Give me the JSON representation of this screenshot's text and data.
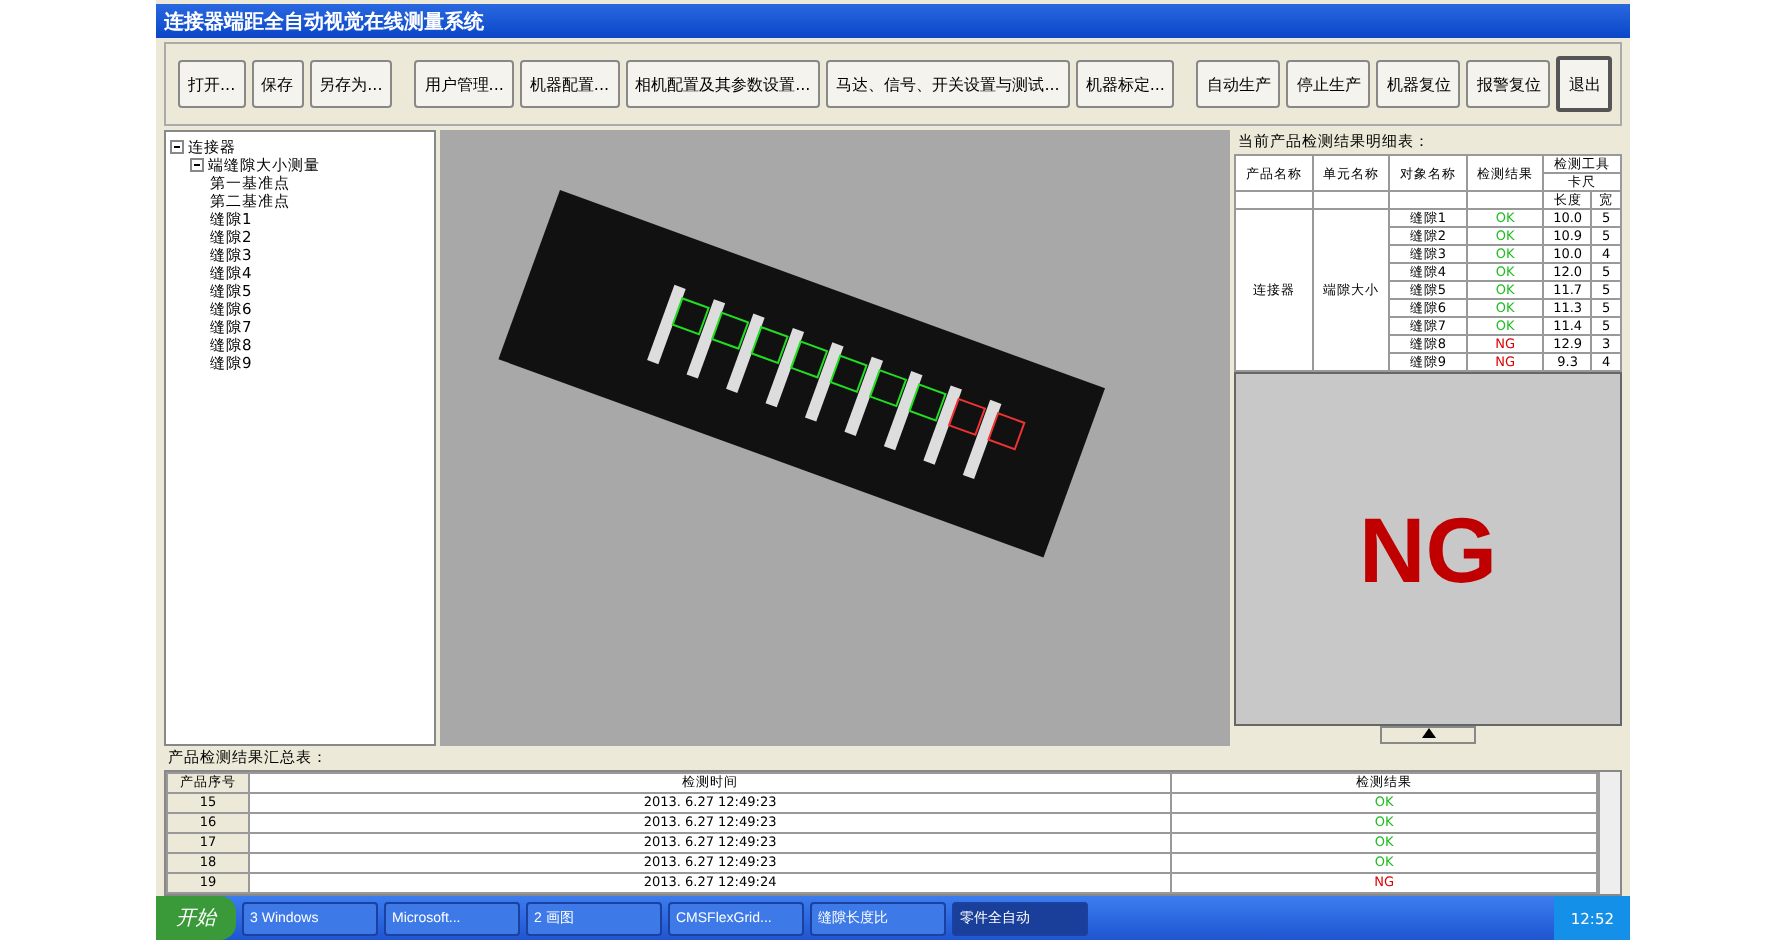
{
  "window": {
    "title": "连接器端距全自动视觉在线测量系统"
  },
  "toolbar": [
    "打开...",
    "保存",
    "另存为...",
    "用户管理...",
    "机器配置...",
    "相机配置及其参数设置...",
    "马达、信号、开关设置与测试...",
    "机器标定...",
    "自动生产",
    "停止生产",
    "机器复位",
    "报警复位"
  ],
  "exit_button": "退出",
  "tree": [
    {
      "label": "连接器",
      "expanded": true,
      "children": [
        {
          "label": "端缝隙大小测量",
          "expanded": true,
          "children": [
            {
              "label": "第一基准点"
            },
            {
              "label": "第二基准点"
            },
            {
              "label": "缝隙1"
            },
            {
              "label": "缝隙2"
            },
            {
              "label": "缝隙3"
            },
            {
              "label": "缝隙4"
            },
            {
              "label": "缝隙5"
            },
            {
              "label": "缝隙6"
            },
            {
              "label": "缝隙7"
            },
            {
              "label": "缝隙8"
            },
            {
              "label": "缝隙9"
            }
          ]
        }
      ]
    }
  ],
  "detail": {
    "title": "当前产品检测结果明细表：",
    "columns": [
      "产品名称",
      "单元名称",
      "对象名称",
      "检测结果",
      "检测工具"
    ],
    "tool_name": "卡尺",
    "subcolumns": [
      "长度",
      "宽"
    ],
    "product": "连接器",
    "unit": "端隙大小",
    "rows": [
      {
        "object": "缝隙1",
        "result": "OK",
        "pass": true,
        "length": "10.0",
        "column_6": "5"
      },
      {
        "object": "缝隙2",
        "result": "OK",
        "pass": true,
        "length": "10.9",
        "column_6": "5"
      },
      {
        "object": "缝隙3",
        "result": "OK",
        "pass": true,
        "length": "10.0",
        "column_6": "4"
      },
      {
        "object": "缝隙4",
        "result": "OK",
        "pass": true,
        "length": "12.0",
        "column_6": "5"
      },
      {
        "object": "缝隙5",
        "result": "OK",
        "pass": true,
        "length": "11.7",
        "column_6": "5"
      },
      {
        "object": "缝隙6",
        "result": "OK",
        "pass": true,
        "length": "11.3",
        "column_6": "5"
      },
      {
        "object": "缝隙7",
        "result": "OK",
        "pass": true,
        "length": "11.4",
        "column_6": "5"
      },
      {
        "object": "缝隙8",
        "result": "NG",
        "pass": false,
        "length": "12.9",
        "column_6": "3"
      },
      {
        "object": "缝隙9",
        "result": "NG",
        "pass": false,
        "length": "9.3",
        "column_6": "4"
      }
    ]
  },
  "verdict": {
    "text": "NG",
    "pass": false
  },
  "summary": {
    "title": "产品检测结果汇总表：",
    "columns": [
      "产品序号",
      "检测时间",
      "检测结果"
    ],
    "rows": [
      {
        "no": "15",
        "time": "2013. 6.27 12:49:23",
        "result": "OK",
        "pass": true
      },
      {
        "no": "16",
        "time": "2013. 6.27 12:49:23",
        "result": "OK",
        "pass": true
      },
      {
        "no": "17",
        "time": "2013. 6.27 12:49:23",
        "result": "OK",
        "pass": true
      },
      {
        "no": "18",
        "time": "2013. 6.27 12:49:23",
        "result": "OK",
        "pass": true
      },
      {
        "no": "19",
        "time": "2013. 6.27 12:49:24",
        "result": "NG",
        "pass": false
      }
    ]
  },
  "taskbar": {
    "start": "开始",
    "tasks": [
      {
        "label": "3 Windows",
        "selected": false
      },
      {
        "label": "Microsoft...",
        "selected": false
      },
      {
        "label": "2 画图",
        "selected": false
      },
      {
        "label": "CMSFlexGrid...",
        "selected": false
      },
      {
        "label": "缝隙长度比",
        "selected": false
      },
      {
        "label": "零件全自动",
        "selected": true
      }
    ],
    "clock": "12:52"
  }
}
